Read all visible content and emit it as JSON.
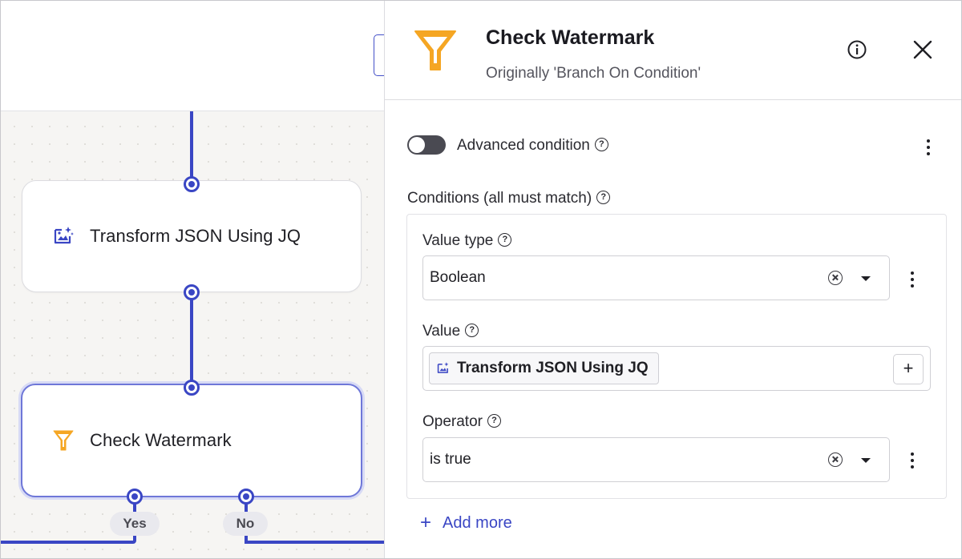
{
  "canvas": {
    "nodes": [
      {
        "label": "Transform JSON Using JQ",
        "icon": "image-sparkle-icon"
      },
      {
        "label": "Check Watermark",
        "icon": "filter-icon"
      }
    ],
    "branches": {
      "yes": "Yes",
      "no": "No"
    }
  },
  "panel": {
    "title": "Check Watermark",
    "subtitle": "Originally 'Branch On Condition'",
    "icon": "filter-icon",
    "advanced_toggle": {
      "label": "Advanced condition",
      "on": false
    },
    "conditions_label": "Conditions (all must match)",
    "value_type": {
      "label": "Value type",
      "selected": "Boolean"
    },
    "value": {
      "label": "Value",
      "chip": "Transform JSON Using JQ",
      "add": "+"
    },
    "operator": {
      "label": "Operator",
      "selected": "is true"
    },
    "add_more": "Add more"
  },
  "colors": {
    "accent": "#3a46c4",
    "filter_orange": "#f5a623",
    "toggle_off": "#4a4a52"
  }
}
